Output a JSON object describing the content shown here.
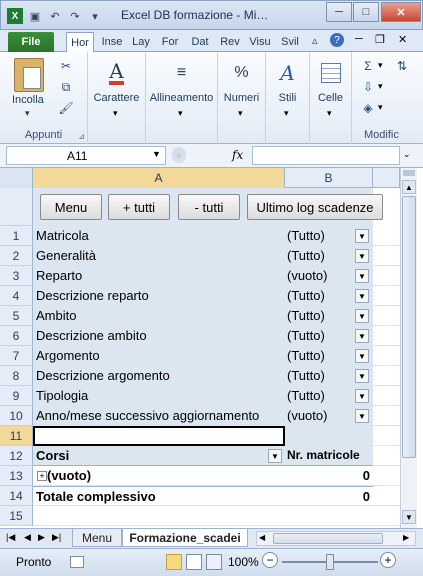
{
  "window": {
    "title": "Excel DB formazione - Mi…"
  },
  "tabs": [
    "File",
    "Hor",
    "Inse",
    "Lay",
    "For",
    "Dat",
    "Rev",
    "Visu",
    "Svil"
  ],
  "ribbon": {
    "groups": [
      {
        "label": "Appunti",
        "button": "Incolla"
      },
      {
        "label": "",
        "button": "Carattere"
      },
      {
        "label": "",
        "button": "Allineamento"
      },
      {
        "label": "",
        "button": "Numeri"
      },
      {
        "label": "",
        "button": "Stili"
      },
      {
        "label": "",
        "button": "Celle"
      },
      {
        "label": "Modific",
        "button": ""
      }
    ]
  },
  "formula": {
    "namebox": "A11",
    "fx": "fx",
    "value": ""
  },
  "columns": {
    "a": "A",
    "b": "B"
  },
  "buttons": {
    "menu": "Menu",
    "plus": "+ tutti",
    "minus": "- tutti",
    "last": "Ultimo log scadenze"
  },
  "rows": [
    {
      "n": "1",
      "a": "Matricola",
      "b": "(Tutto)"
    },
    {
      "n": "2",
      "a": "Generalità",
      "b": "(Tutto)"
    },
    {
      "n": "3",
      "a": "Reparto",
      "b": "(vuoto)"
    },
    {
      "n": "4",
      "a": "Descrizione reparto",
      "b": "(Tutto)"
    },
    {
      "n": "5",
      "a": "Ambito",
      "b": "(Tutto)"
    },
    {
      "n": "6",
      "a": "Descrizione ambito",
      "b": "(Tutto)"
    },
    {
      "n": "7",
      "a": "Argomento",
      "b": "(Tutto)"
    },
    {
      "n": "8",
      "a": "Descrizione argomento",
      "b": "(Tutto)"
    },
    {
      "n": "9",
      "a": "Tipologia",
      "b": "(Tutto)"
    },
    {
      "n": "10",
      "a": "Anno/mese successivo aggiornamento",
      "b": "(vuoto)"
    },
    {
      "n": "11",
      "a": "",
      "b": ""
    },
    {
      "n": "12",
      "a": "Corsi",
      "b": "Nr. matricole"
    },
    {
      "n": "13",
      "a": "(vuoto)",
      "b": "0"
    },
    {
      "n": "14",
      "a": "Totale complessivo",
      "b": "0"
    },
    {
      "n": "15",
      "a": "",
      "b": ""
    }
  ],
  "sheets": [
    "Menu",
    "Formazione_scadei"
  ],
  "status": {
    "ready": "Pronto",
    "zoom": "100%"
  }
}
